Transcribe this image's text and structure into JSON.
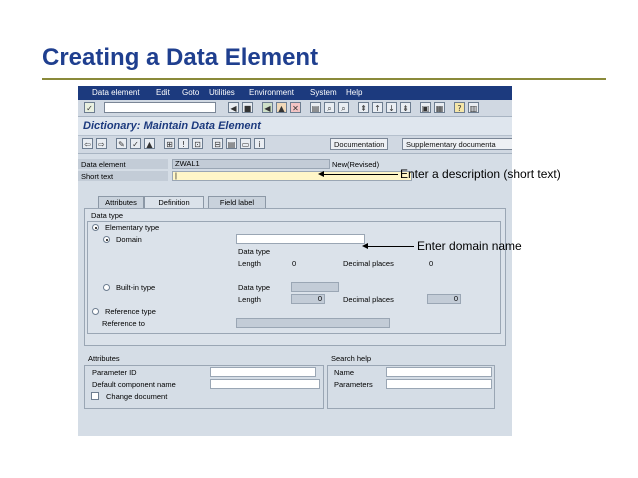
{
  "slide": {
    "title": "Creating a Data Element"
  },
  "menu": {
    "items": [
      "Data element",
      "Edit",
      "Goto",
      "Utilities",
      "Environment",
      "System",
      "Help"
    ]
  },
  "screen": {
    "title": "Dictionary: Maintain Data Element"
  },
  "toolbar": {
    "documentation_label": "Documentation",
    "supplementary_label": "Supplementary documenta"
  },
  "header": {
    "data_element_label": "Data element",
    "data_element_value": "ZWAL1",
    "status": "New(Revised)",
    "short_text_label": "Short text",
    "short_text_value": "|"
  },
  "tabs": [
    {
      "label": "Attributes",
      "active": false
    },
    {
      "label": "Definition",
      "active": true
    },
    {
      "label": "Field label",
      "active": false
    }
  ],
  "data_type": {
    "group_title": "Data type",
    "elementary_label": "Elementary type",
    "domain_label": "Domain",
    "domain_value": "",
    "dt_label_1": "Data type",
    "length_label_1": "Length",
    "length_value_1": "0",
    "decimal_label_1": "Decimal places",
    "decimal_value_1": "0",
    "builtin_label": "Built-in type",
    "dt_label_2": "Data type",
    "length_label_2": "Length",
    "length_value_2": "0",
    "decimal_label_2": "Decimal places",
    "decimal_value_2": "0",
    "reference_type_label": "Reference type",
    "reference_to_label": "Reference to"
  },
  "attributes": {
    "group_title": "Attributes",
    "parameter_id_label": "Parameter ID",
    "default_component_label": "Default component name",
    "change_document_label": "Change document"
  },
  "search_help": {
    "group_title": "Search help",
    "name_label": "Name",
    "parameters_label": "Parameters"
  },
  "callouts": {
    "short_text_note": "Enter a description (short text)",
    "domain_note": "Enter domain name"
  },
  "colors": {
    "title": "#1f3f8f",
    "menubar": "#1c3a7e",
    "screen_bg": "#d5dde6",
    "input_highlight": "#fff6c8"
  }
}
